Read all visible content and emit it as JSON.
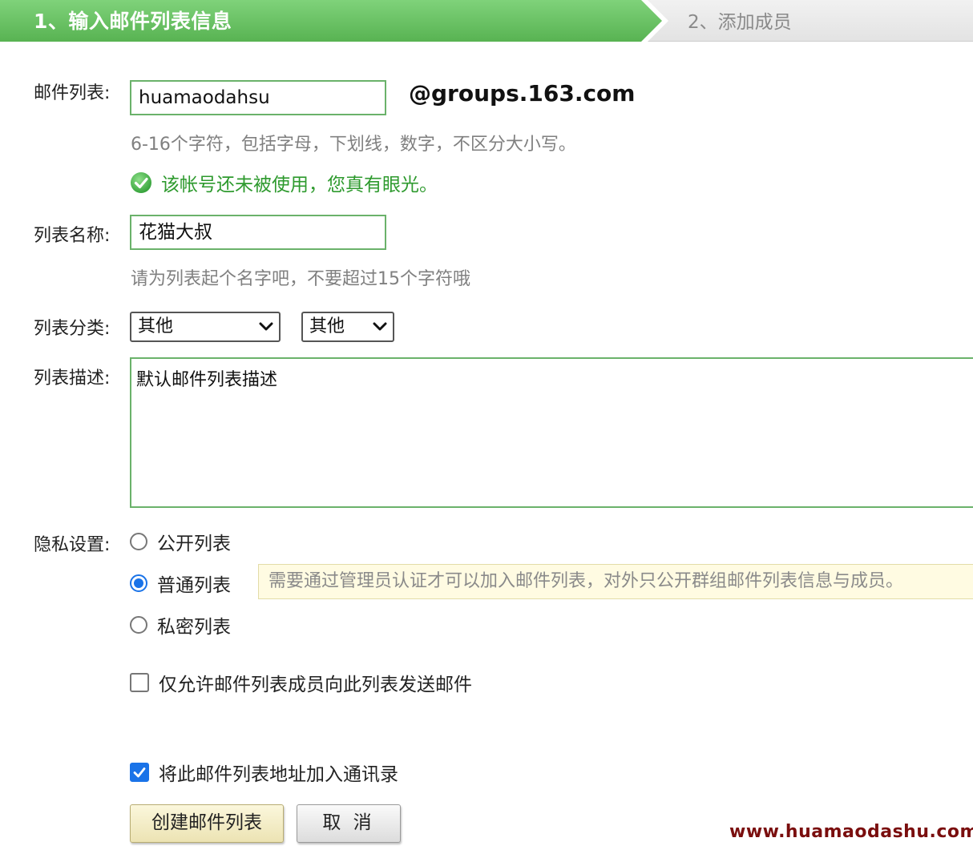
{
  "steps": {
    "active_label": "1、输入邮件列表信息",
    "next_label": "2、添加成员"
  },
  "form": {
    "list_address": {
      "label": "邮件列表:",
      "value": "huamaodahsu",
      "domain": "@groups.163.com",
      "hint": "6-16个字符，包括字母，下划线，数字，不区分大小写。",
      "status": "该帐号还未被使用，您真有眼光。",
      "status_icon": "check-circle-icon",
      "status_color": "#2e9a2e"
    },
    "list_name": {
      "label": "列表名称:",
      "value": "花猫大叔",
      "hint": "请为列表起个名字吧，不要超过15个字符哦"
    },
    "category": {
      "label": "列表分类:",
      "primary_selected": "其他",
      "secondary_selected": "其他"
    },
    "description": {
      "label": "列表描述:",
      "value": "默认邮件列表描述"
    },
    "privacy": {
      "label": "隐私设置:",
      "options": [
        {
          "label": "公开列表",
          "checked": false
        },
        {
          "label": "普通列表",
          "checked": true
        },
        {
          "label": "私密列表",
          "checked": false
        }
      ],
      "tip": "需要通过管理员认证才可以加入邮件列表，对外只公开群组邮件列表信息与成员。"
    },
    "members_only": {
      "label": "仅允许邮件列表成员向此列表发送邮件",
      "checked": false
    },
    "add_to_contacts": {
      "label": "将此邮件列表地址加入通讯录",
      "checked": true
    }
  },
  "buttons": {
    "create_label": "创建邮件列表",
    "cancel_label": "取 消"
  },
  "watermark": "www.huamaodashu.com",
  "colors": {
    "accent_green": "#58b352",
    "input_border": "#6ab26a",
    "checked_blue": "#1a73e8",
    "watermark": "#7a0e0e"
  }
}
